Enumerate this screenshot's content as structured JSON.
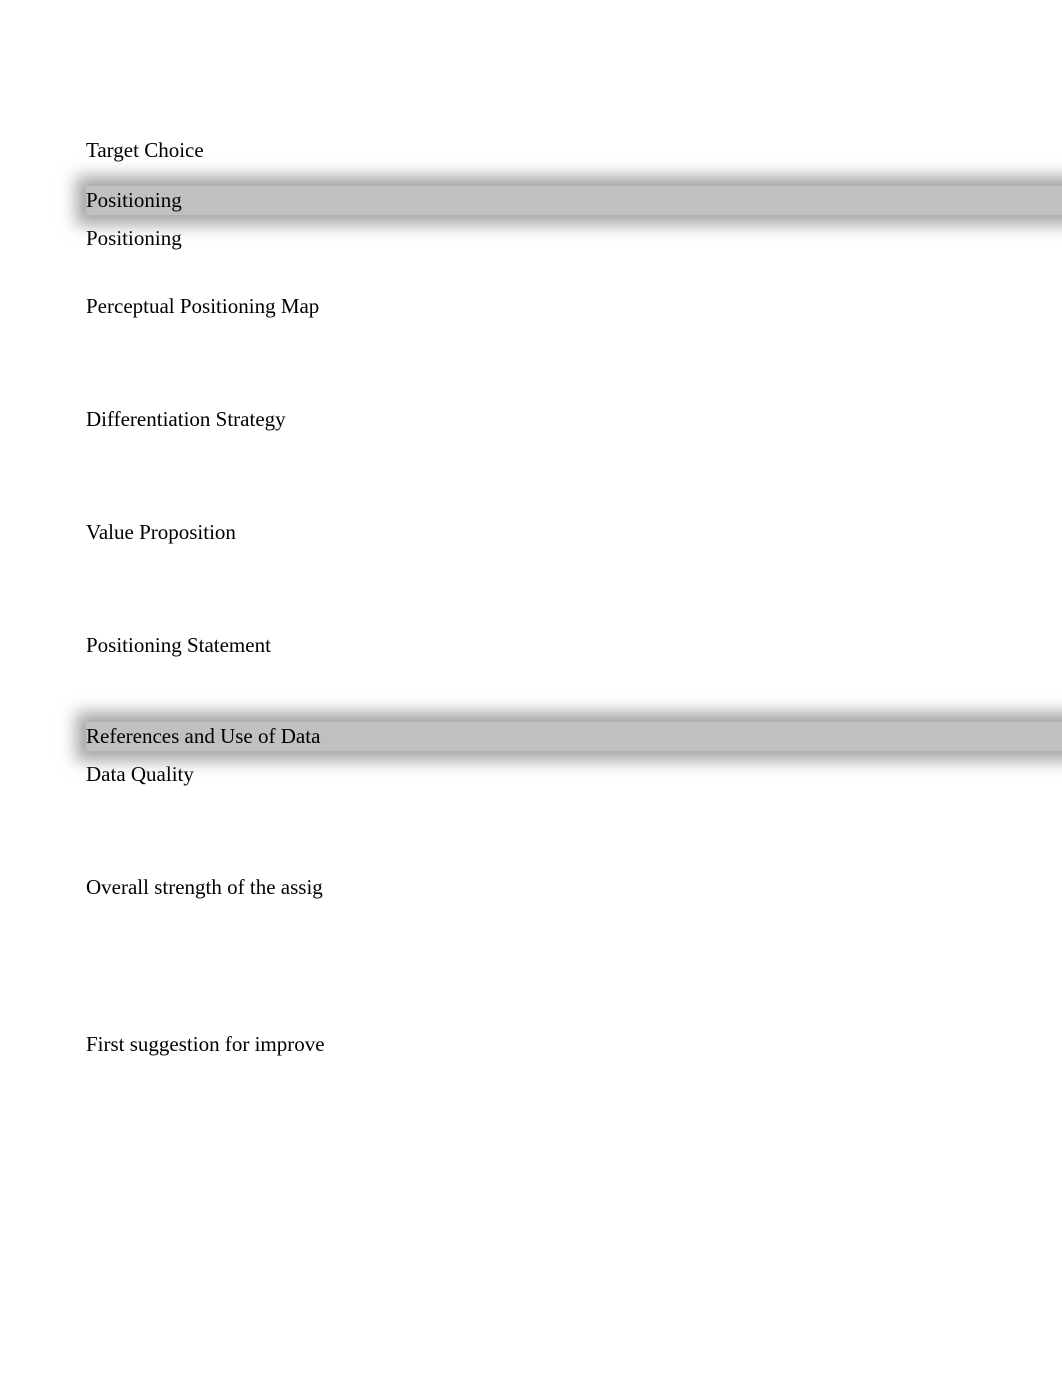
{
  "items": [
    {
      "text": "Target Choice",
      "type": "item"
    },
    {
      "text": "Positioning",
      "type": "header"
    },
    {
      "text": "Positioning",
      "type": "item"
    },
    {
      "text": "Perceptual Positioning Map",
      "type": "item",
      "gapBefore": "md"
    },
    {
      "text": "Differentiation Strategy",
      "type": "item",
      "gapBefore": "lg"
    },
    {
      "text": "Value Proposition",
      "type": "item",
      "gapBefore": "lg"
    },
    {
      "text": "Positioning Statement",
      "type": "item",
      "gapBefore": "lg"
    },
    {
      "text": "References and Use of Data",
      "type": "header",
      "gapBefore": "md"
    },
    {
      "text": "Data Quality",
      "type": "item"
    },
    {
      "text": "Overall strength of the assig",
      "type": "item",
      "gapBefore": "lg"
    },
    {
      "text": "First suggestion for improve",
      "type": "item",
      "gapBefore": "xl"
    }
  ]
}
